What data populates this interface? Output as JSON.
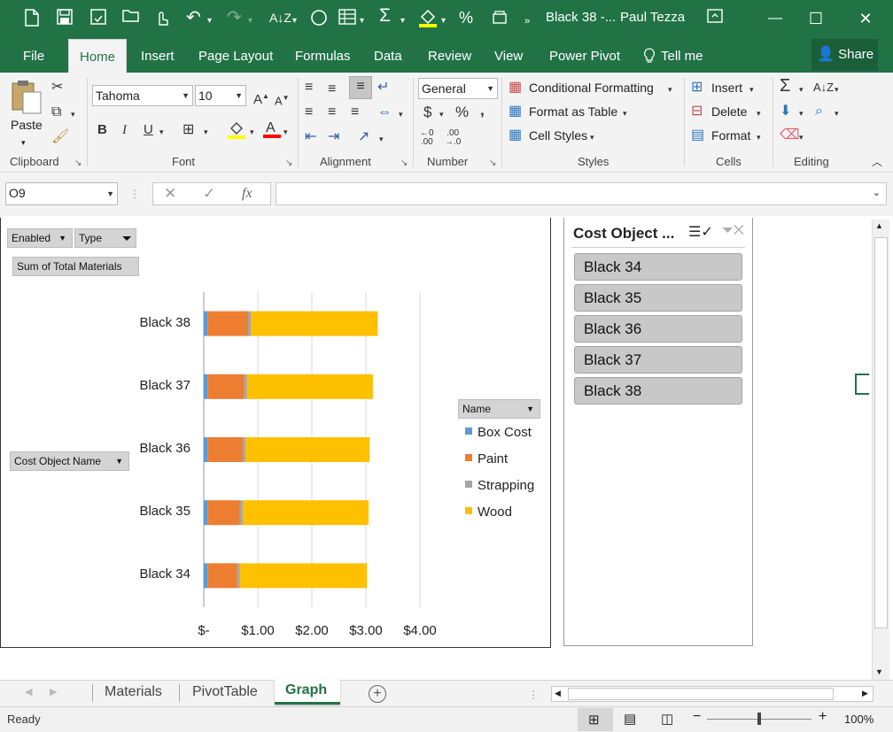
{
  "title": {
    "doc": "Black 38 -...",
    "user": "Paul Tezza"
  },
  "window_controls": {
    "minimize": "—",
    "maximize": "☐",
    "close": "✕"
  },
  "quick_access": {
    "new": "🗋",
    "save": "💾",
    "undo": "↶",
    "redo": "↷"
  },
  "tabs": [
    "File",
    "Home",
    "Insert",
    "Page Layout",
    "Formulas",
    "Data",
    "Review",
    "View",
    "Power Pivot"
  ],
  "tell_me": "Tell me",
  "share": "Share",
  "ribbon": {
    "clipboard": {
      "label": "Clipboard",
      "paste": "Paste"
    },
    "font": {
      "label": "Font",
      "name": "Tahoma",
      "size": "10",
      "bold": "B",
      "italic": "I",
      "underline": "U"
    },
    "alignment": {
      "label": "Alignment"
    },
    "number": {
      "label": "Number",
      "format": "General",
      "currency": "$",
      "percent": "%",
      "comma": ","
    },
    "styles": {
      "label": "Styles",
      "conditional": "Conditional Formatting",
      "table": "Format as Table",
      "cell": "Cell Styles"
    },
    "cells": {
      "label": "Cells",
      "insert": "Insert",
      "delete": "Delete",
      "format": "Format"
    },
    "editing": {
      "label": "Editing"
    }
  },
  "formula_bar": {
    "name_box": "O9",
    "fx": "fx",
    "value": ""
  },
  "pivot_fields": {
    "filter1": "Enabled",
    "filter2": "Type",
    "values": "Sum of Total Materials",
    "axis": "Cost Object Name",
    "legend": "Name"
  },
  "slicer": {
    "title": "Cost Object ...",
    "items": [
      "Black 34",
      "Black 35",
      "Black 36",
      "Black 37",
      "Black 38"
    ]
  },
  "sheet_tabs": [
    "Materials",
    "PivotTable",
    "Graph"
  ],
  "active_sheet": "Graph",
  "status": {
    "ready": "Ready",
    "zoom": "100%"
  },
  "colors": {
    "box_cost": "#5b9bd5",
    "paint": "#ed7d31",
    "strapping": "#a5a5a5",
    "wood": "#ffc000",
    "excel_green": "#217346"
  },
  "chart_data": {
    "type": "bar",
    "orientation": "horizontal",
    "stacked": true,
    "categories": [
      "Black 38",
      "Black 37",
      "Black 36",
      "Black 35",
      "Black 34"
    ],
    "series": [
      {
        "name": "Box Cost",
        "values": [
          0.07,
          0.07,
          0.07,
          0.07,
          0.07
        ]
      },
      {
        "name": "Paint",
        "values": [
          0.75,
          0.68,
          0.65,
          0.6,
          0.55
        ]
      },
      {
        "name": "Strapping",
        "values": [
          0.05,
          0.05,
          0.05,
          0.05,
          0.05
        ]
      },
      {
        "name": "Wood",
        "values": [
          2.35,
          2.33,
          2.3,
          2.33,
          2.35
        ]
      }
    ],
    "x_ticks": [
      "$-",
      "$1.00",
      "$2.00",
      "$3.00",
      "$4.00"
    ],
    "xlim": [
      0,
      4
    ],
    "grid": true,
    "legend_position": "right"
  }
}
